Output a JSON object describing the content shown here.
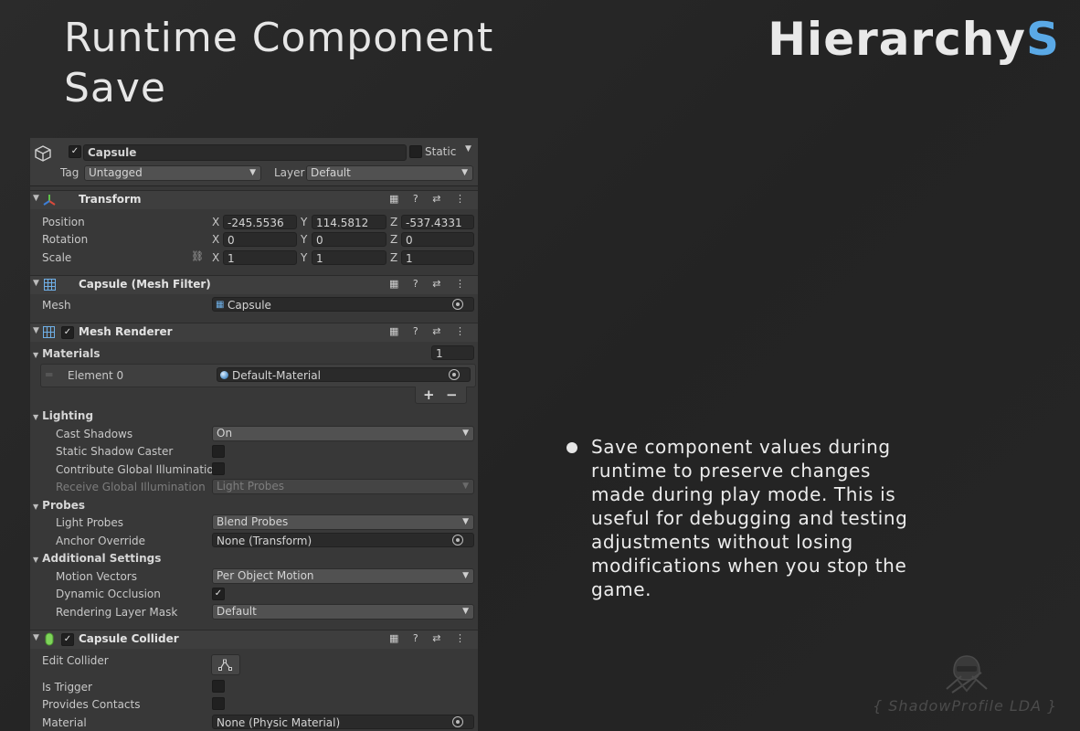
{
  "page": {
    "title_line1": "Runtime Component",
    "title_line2": "Save",
    "logo_main": "Hierarchy",
    "logo_accent": "S",
    "bullet_text": "Save component values during runtime to preserve changes made during play mode. This is useful for debugging and testing adjustments without losing modifications when you stop the game.",
    "watermark": "{ ShadowProfile LDA }"
  },
  "colors": {
    "accent": "#5aa9e6",
    "panel_bg": "#383838",
    "page_bg": "#262626"
  },
  "inspector": {
    "object_name": "Capsule",
    "static_label": "Static",
    "tag_label": "Tag",
    "tag_value": "Untagged",
    "layer_label": "Layer",
    "layer_value": "Default",
    "transform": {
      "title": "Transform",
      "position_label": "Position",
      "rotation_label": "Rotation",
      "scale_label": "Scale",
      "position": {
        "x": "-245.5536",
        "y": "114.5812",
        "z": "-537.4331"
      },
      "rotation": {
        "x": "0",
        "y": "0",
        "z": "0"
      },
      "scale": {
        "x": "1",
        "y": "1",
        "z": "1"
      },
      "axis_x": "X",
      "axis_y": "Y",
      "axis_z": "Z"
    },
    "mesh_filter": {
      "title": "Capsule (Mesh Filter)",
      "mesh_label": "Mesh",
      "mesh_value": "Capsule"
    },
    "mesh_renderer": {
      "title": "Mesh Renderer",
      "materials_label": "Materials",
      "materials_count": "1",
      "element0_label": "Element 0",
      "element0_value": "Default-Material",
      "add_label": "+",
      "remove_label": "−",
      "lighting_label": "Lighting",
      "cast_shadows_label": "Cast Shadows",
      "cast_shadows_value": "On",
      "static_shadow_caster_label": "Static Shadow Caster",
      "contribute_gi_label": "Contribute Global Illumination",
      "receive_gi_label": "Receive Global Illumination",
      "receive_gi_value": "Light Probes",
      "probes_label": "Probes",
      "light_probes_label": "Light Probes",
      "light_probes_value": "Blend Probes",
      "anchor_override_label": "Anchor Override",
      "anchor_override_value": "None (Transform)",
      "additional_label": "Additional Settings",
      "motion_vectors_label": "Motion Vectors",
      "motion_vectors_value": "Per Object Motion",
      "dynamic_occlusion_label": "Dynamic Occlusion",
      "rendering_layer_label": "Rendering Layer Mask",
      "rendering_layer_value": "Default"
    },
    "capsule_collider": {
      "title": "Capsule Collider",
      "edit_collider_label": "Edit Collider",
      "is_trigger_label": "Is Trigger",
      "provides_contacts_label": "Provides Contacts",
      "material_label": "Material",
      "material_value": "None (Physic Material)"
    },
    "check_mark": "✓",
    "tools_icons": "▦ ? ⇄ ⋮"
  }
}
